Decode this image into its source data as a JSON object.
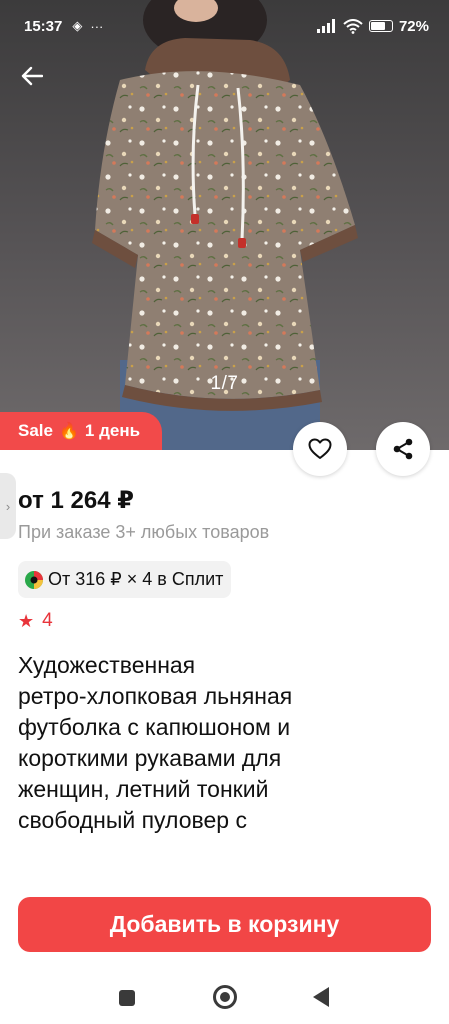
{
  "status_bar": {
    "time": "15:37",
    "glyph_a": "◈",
    "glyph_b": "···",
    "battery_percent": "72%",
    "battery_level": 0.72
  },
  "gallery": {
    "page_indicator": "1/7"
  },
  "sale_badge": {
    "label": "Sale",
    "fire_icon": "🔥",
    "duration": "1 день"
  },
  "product": {
    "price": "от 1 264 ₽",
    "price_note": "При заказе 3+ любых товаров",
    "split_text": "От 316 ₽ × 4 в Сплит",
    "rating": "4",
    "title_lines": [
      "Художественная",
      "ретро-хлопковая льняная",
      "футболка с капюшоном и",
      "короткими рукавами для",
      "женщин, летний тонкий",
      "свободный пуловер с"
    ]
  },
  "actions": {
    "add_to_cart": "Добавить в корзину"
  },
  "colors": {
    "accent": "#f24646",
    "rating": "#e8343b",
    "muted_text": "#9a9a9a"
  },
  "icons": {
    "back": "arrow-left-icon",
    "favorite": "heart-icon",
    "share": "share-icon",
    "rating": "star-icon",
    "split": "split-logo-icon"
  }
}
